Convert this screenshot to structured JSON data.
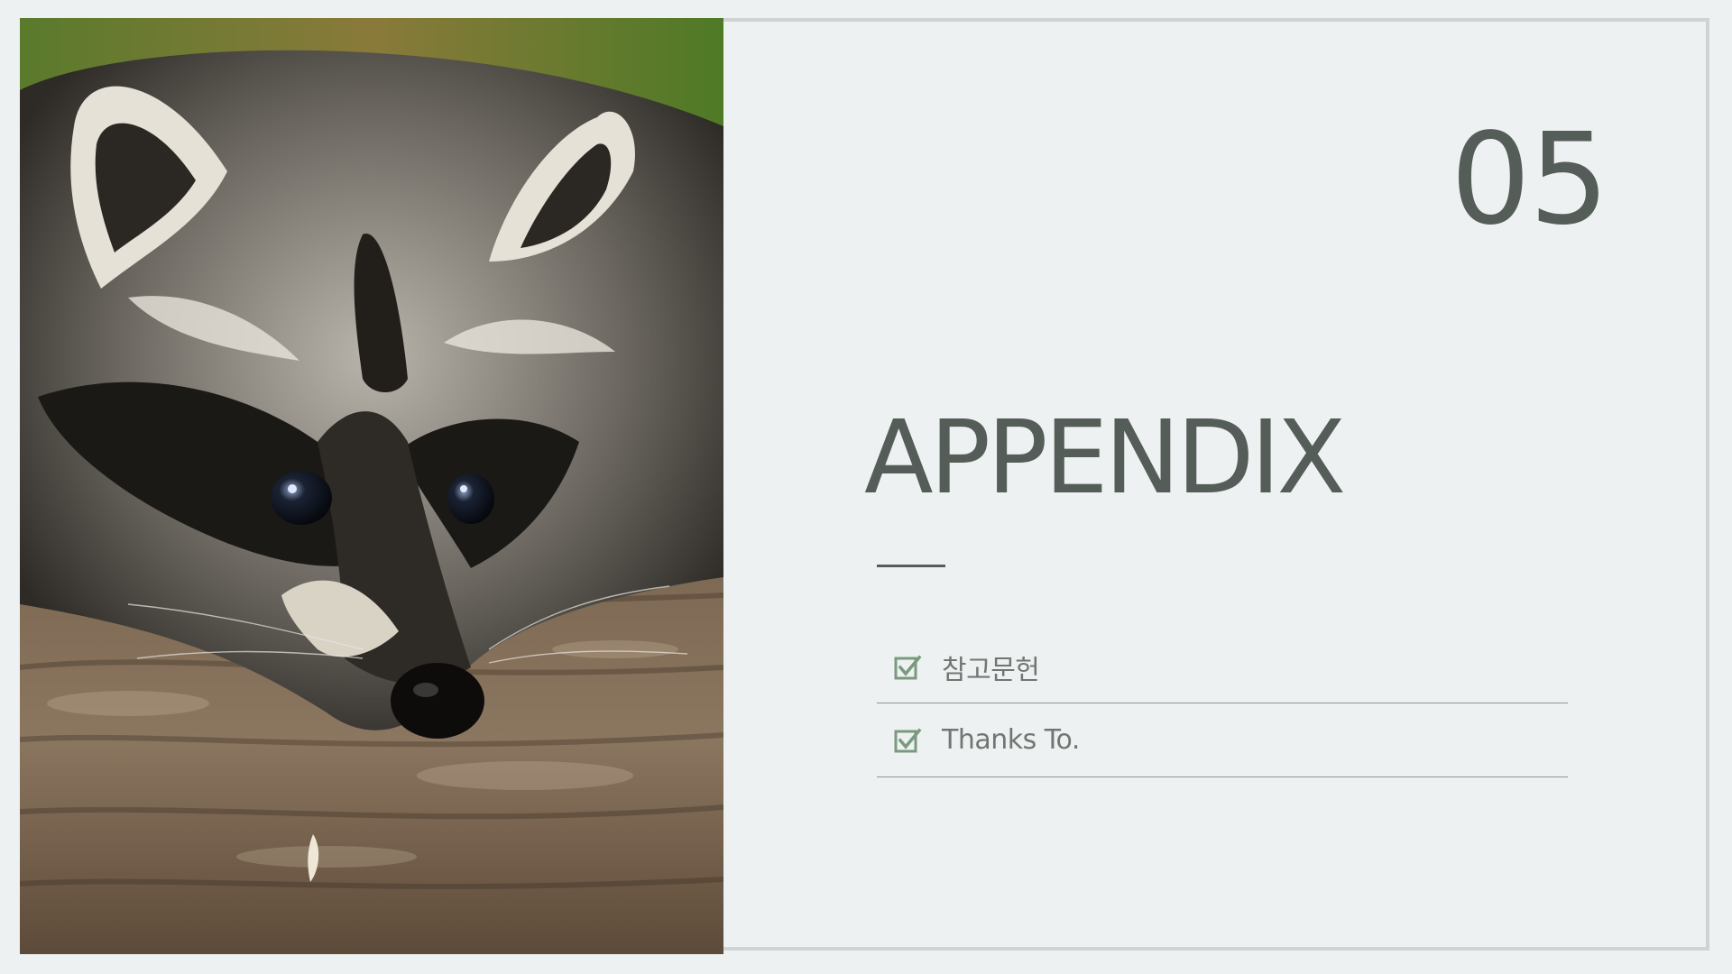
{
  "slide": {
    "section_number": "05",
    "title": "APPENDIX",
    "items": [
      {
        "label": "참고문헌",
        "icon": "checkbox-checked-icon"
      },
      {
        "label": "Thanks To.",
        "icon": "checkbox-checked-icon"
      }
    ],
    "photo": {
      "subject": "raccoon-photo"
    }
  },
  "colors": {
    "background": "#eef1f1",
    "text_dark": "#545d57",
    "text_muted": "#707772",
    "accent_green": "#7a9a7e",
    "frame_border": "#cfd3d3"
  }
}
